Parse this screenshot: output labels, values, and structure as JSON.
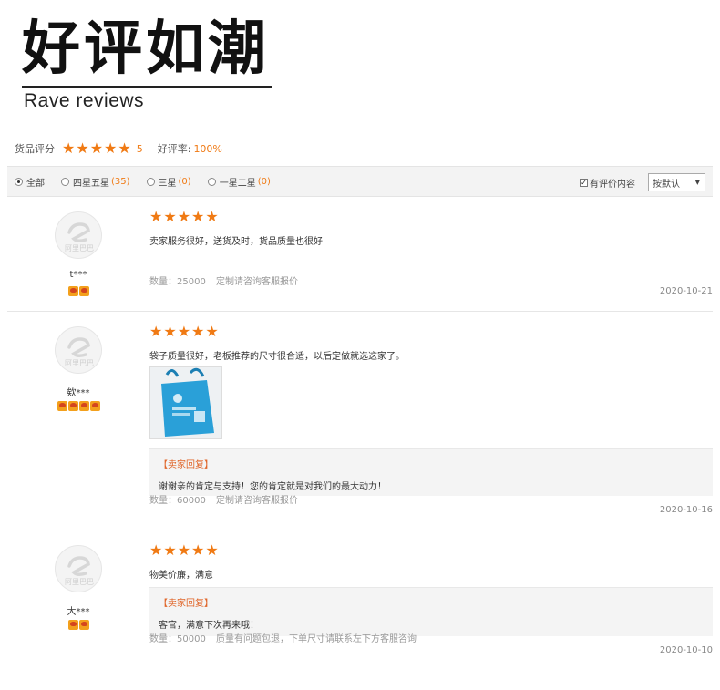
{
  "header": {
    "title_zh": "好评如潮",
    "title_en": "Rave reviews"
  },
  "summary": {
    "goods_rating_label": "货品评分",
    "goods_rating_value": "5",
    "good_rate_label": "好评率:",
    "good_rate_value": "100%",
    "stars": 5
  },
  "filter": {
    "options": [
      {
        "label": "全部",
        "count": "",
        "selected": true
      },
      {
        "label": "四星五星",
        "count": "(35)",
        "selected": false
      },
      {
        "label": "三星",
        "count": "(0)",
        "selected": false
      },
      {
        "label": "一星二星",
        "count": "(0)",
        "selected": false
      }
    ],
    "checkbox_label": "有评价内容",
    "checkbox_checked": true,
    "sort_value": "按默认"
  },
  "reviews": [
    {
      "username": "t***",
      "medals": 2,
      "stars": 5,
      "text": "卖家服务很好，送货及时，货品质量也很好",
      "quantity": "数量：25000",
      "meta_note": "定制请咨询客服报价",
      "date": "2020-10-21"
    },
    {
      "username": "欸***",
      "medals": 4,
      "stars": 5,
      "text": "袋子质量很好，老板推荐的尺寸很合适，以后定做就选这家了。",
      "has_photo": true,
      "reply_title": "【卖家回复】",
      "reply_text": "谢谢亲的肯定与支持！您的肯定就是对我们的最大动力！",
      "quantity": "数量：60000",
      "meta_note": "定制请咨询客服报价",
      "date": "2020-10-16"
    },
    {
      "username": "大***",
      "medals": 2,
      "stars": 5,
      "text": "物美价廉，满意",
      "reply_title": "【卖家回复】",
      "reply_text": "客官，满意下次再来哦！",
      "quantity": "数量：50000",
      "meta_note": "质量有问题包退，下单尺寸请联系左下方客服咨询",
      "date": "2020-10-10"
    }
  ],
  "avatar_logo_text": "阿里巴巴",
  "colors": {
    "accent": "#f07a14",
    "reply_title": "#e0662a"
  }
}
